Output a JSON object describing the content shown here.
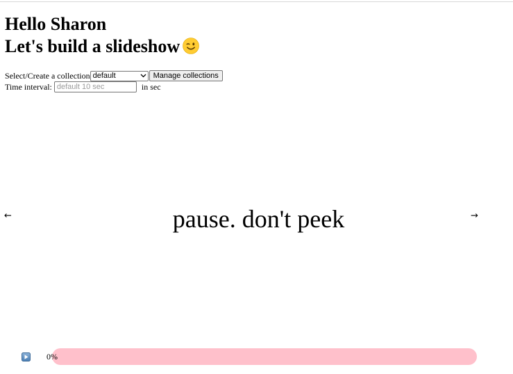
{
  "header": {
    "greeting": "Hello Sharon",
    "subtitle": "Let's build a slideshow",
    "subtitle_icon": "winking-face-emoji"
  },
  "controls": {
    "collection_label": "Select/Create a collection",
    "collection_selected": "default",
    "manage_button": "Manage collections",
    "interval_label": "Time interval:",
    "interval_value": "",
    "interval_placeholder": "default 10 sec",
    "interval_unit": "in sec"
  },
  "slideshow": {
    "prev_arrow": "←",
    "next_arrow": "→",
    "current_text": "pause. don't peek"
  },
  "player": {
    "play_icon": "play-icon",
    "progress_label": "0%",
    "progress_fraction": 0,
    "bar_color": "#ffc0cb"
  }
}
